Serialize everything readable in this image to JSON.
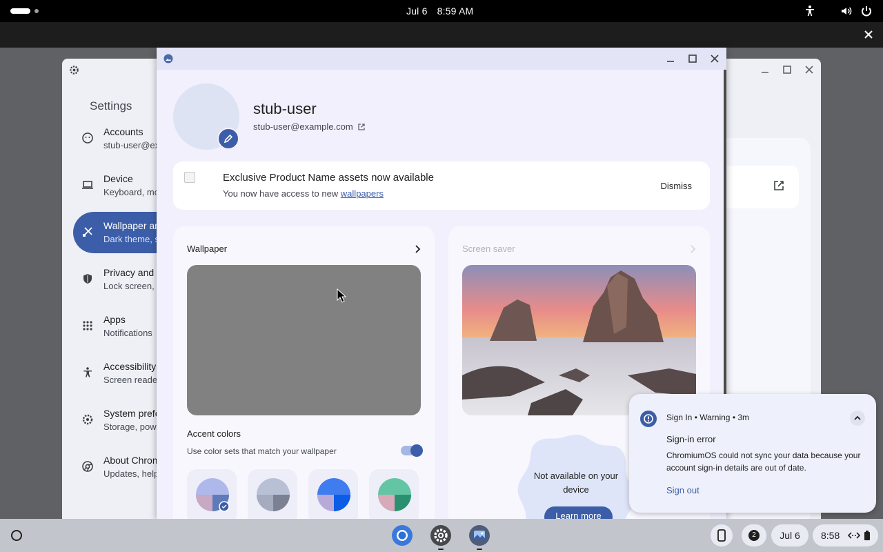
{
  "topbar": {
    "date": "Jul 6",
    "time": "8:59 AM"
  },
  "settings": {
    "title": "Settings",
    "items": [
      {
        "title": "Accounts",
        "subtitle": "stub-user@ex"
      },
      {
        "title": "Device",
        "subtitle": "Keyboard, mo"
      },
      {
        "title": "Wallpaper ar",
        "subtitle": "Dark theme, s"
      },
      {
        "title": "Privacy and",
        "subtitle": "Lock screen,"
      },
      {
        "title": "Apps",
        "subtitle": "Notifications"
      },
      {
        "title": "Accessibility",
        "subtitle": "Screen reade"
      },
      {
        "title": "System prefe",
        "subtitle": "Storage, pow"
      },
      {
        "title": "About Chrom",
        "subtitle": "Updates, help"
      }
    ]
  },
  "profile": {
    "name": "stub-user",
    "email": "stub-user@example.com"
  },
  "banner": {
    "title": "Exclusive Product Name assets now available",
    "subtitle_prefix": "You now have access to new ",
    "link": "wallpapers",
    "dismiss": "Dismiss"
  },
  "wallpaper": {
    "heading": "Wallpaper",
    "accent_title": "Accent colors",
    "accent_sub": "Use color sets that match your wallpaper",
    "toggle_on": true
  },
  "screensaver": {
    "heading": "Screen saver",
    "not_available": "Not available on your device",
    "learn_more": "Learn more"
  },
  "notification": {
    "source": "Sign In",
    "level": "Warning",
    "age": "3m",
    "title": "Sign-in error",
    "body": "ChromiumOS could not sync your data because your account sign-in details are out of date.",
    "action": "Sign out"
  },
  "shelf": {
    "badge": "2",
    "date": "Jul 6",
    "time": "8:58"
  },
  "colors": {
    "accent": "#3c5ea8",
    "shelf": "#c2c5cc"
  }
}
